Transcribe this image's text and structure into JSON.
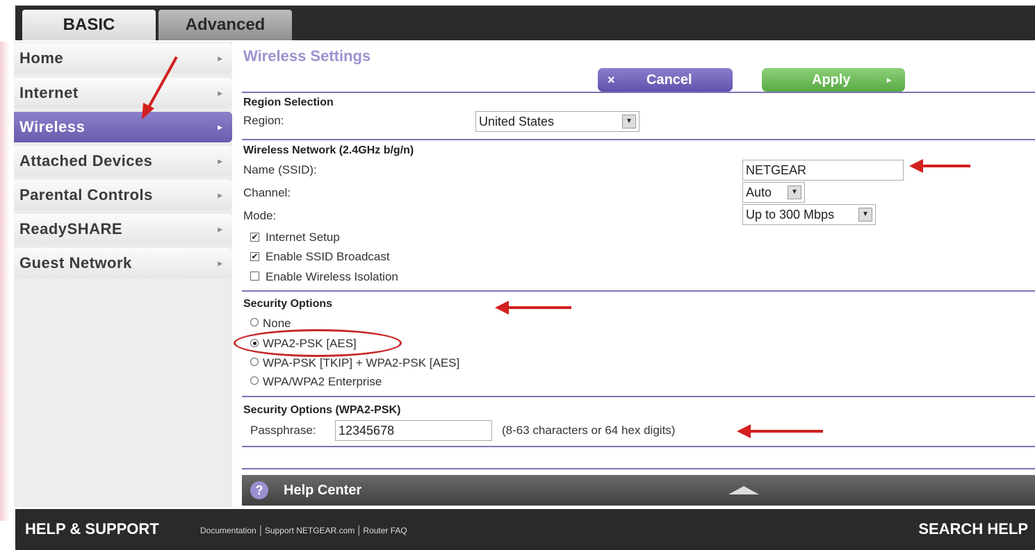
{
  "tabs": {
    "basic": "BASIC",
    "advanced": "Advanced"
  },
  "sidebar": {
    "items": [
      {
        "label": "Home",
        "chevron": "▸"
      },
      {
        "label": "Internet",
        "chevron": "▸"
      },
      {
        "label": "Wireless",
        "chevron": "▸"
      },
      {
        "label": "Attached Devices",
        "chevron": "▸"
      },
      {
        "label": "Parental Controls",
        "chevron": "▸"
      },
      {
        "label": "ReadySHARE",
        "chevron": "▸"
      },
      {
        "label": "Guest Network",
        "chevron": "▸"
      }
    ],
    "active": "Wireless"
  },
  "main": {
    "title": "Wireless Settings",
    "cancel_label": "Cancel",
    "cancel_icon": "×",
    "apply_label": "Apply",
    "apply_icon": "▸",
    "region": {
      "heading": "Region Selection",
      "label": "Region:",
      "value": "United States"
    },
    "network": {
      "heading": "Wireless Network (2.4GHz b/g/n)",
      "ssid_label": "Name (SSID):",
      "ssid_value": "NETGEAR",
      "channel_label": "Channel:",
      "channel_value": "Auto",
      "mode_label": "Mode:",
      "mode_value": "Up to 300 Mbps",
      "checkboxes": [
        {
          "label": "Internet Setup",
          "checked": true
        },
        {
          "label": "Enable SSID Broadcast",
          "checked": true
        },
        {
          "label": "Enable Wireless Isolation",
          "checked": false
        }
      ]
    },
    "security": {
      "heading": "Security Options",
      "options": [
        {
          "label": "None",
          "selected": false
        },
        {
          "label": "WPA2-PSK [AES]",
          "selected": true
        },
        {
          "label": "WPA-PSK [TKIP] + WPA2-PSK [AES]",
          "selected": false
        },
        {
          "label": "WPA/WPA2 Enterprise",
          "selected": false
        }
      ]
    },
    "passphrase": {
      "heading": "Security Options (WPA2-PSK)",
      "label": "Passphrase:",
      "value": "12345678",
      "hint": "(8-63 characters or 64 hex digits)"
    },
    "help_center": "Help Center",
    "help_icon": "?"
  },
  "footer": {
    "help_support": "HELP & SUPPORT",
    "links": [
      "Documentation",
      "Support NETGEAR.com",
      "Router FAQ"
    ],
    "search_help": "SEARCH HELP"
  },
  "colors": {
    "accent": "#6a5bb0",
    "apply": "#57a943",
    "annotation": "#d32020"
  }
}
